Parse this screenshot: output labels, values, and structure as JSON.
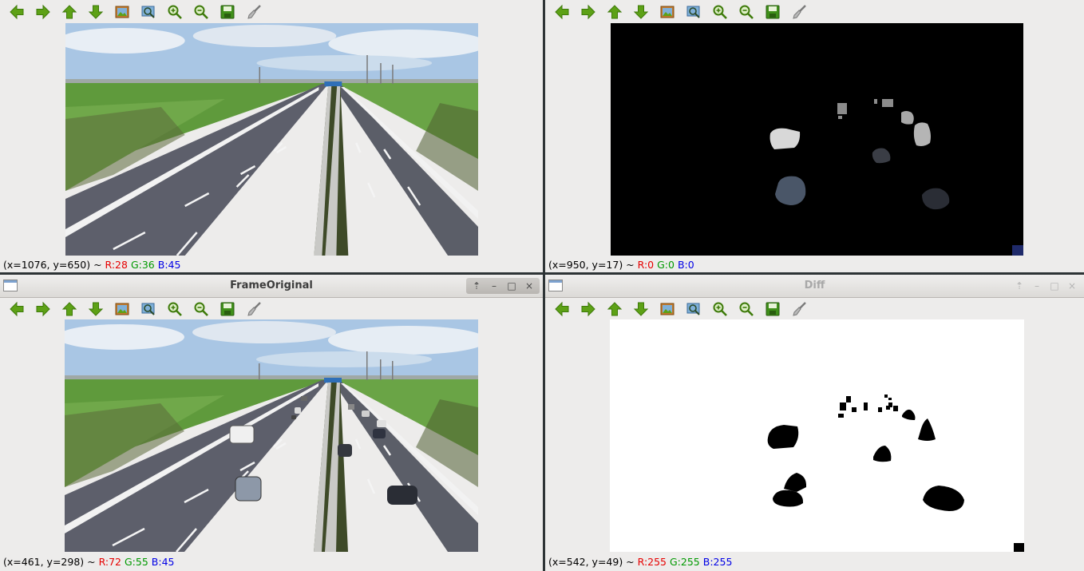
{
  "windows": {
    "top_left": {
      "status": {
        "coord": "(x=1076, y=650) ~",
        "r": "R:28",
        "g": "G:36",
        "b": "B:45"
      }
    },
    "top_right": {
      "status": {
        "coord": "(x=950, y=17) ~",
        "r": "R:0",
        "g": "G:0",
        "b": "B:0"
      }
    },
    "bottom_left": {
      "title": "FrameOriginal",
      "status": {
        "coord": "(x=461, y=298) ~",
        "r": "R:72",
        "g": "G:55",
        "b": "B:45"
      }
    },
    "bottom_right": {
      "title": "Diff",
      "status": {
        "coord": "(x=542, y=49) ~",
        "r": "R:255",
        "g": "G:255",
        "b": "B:255"
      }
    }
  },
  "window_controls": {
    "keep_above": "⇡",
    "minimize": "–",
    "maximize": "□",
    "close": "×"
  },
  "toolbar_icons": [
    "arrow-left-icon",
    "arrow-right-icon",
    "arrow-up-icon",
    "arrow-down-icon",
    "picture-icon",
    "zoom-fit-icon",
    "zoom-in-icon",
    "zoom-out-icon",
    "save-icon",
    "properties-brush-icon"
  ],
  "colors": {
    "window_bg": "#edeceb",
    "arrow_green": "#4e9a06",
    "status_red": "#e60000",
    "status_green": "#009900",
    "status_blue": "#0000e6"
  }
}
